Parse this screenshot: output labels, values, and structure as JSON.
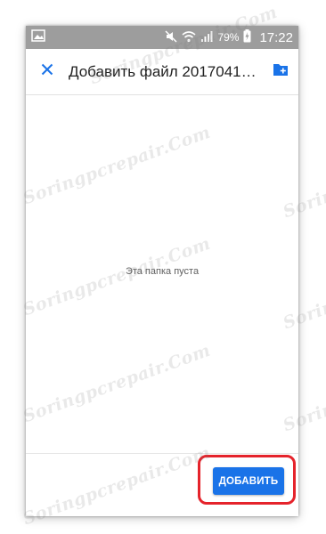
{
  "status_bar": {
    "battery_percent": "79%",
    "time": "17:22",
    "icons": [
      "image-icon",
      "mute-icon",
      "wifi-icon",
      "signal-icon",
      "battery-charging-icon"
    ]
  },
  "toolbar": {
    "close_icon": "close-icon",
    "title": "Добавить файл 2017041…",
    "new_folder_icon": "create-new-folder-icon"
  },
  "content": {
    "empty_message": "Эта папка пуста"
  },
  "footer": {
    "add_button_label": "ДОБАВИТЬ"
  },
  "watermark": {
    "text": "Soringpcrepair.Com"
  },
  "colors": {
    "accent": "#1a73e8",
    "status_bar": "#9d9d9d",
    "highlight": "#e5232b"
  }
}
